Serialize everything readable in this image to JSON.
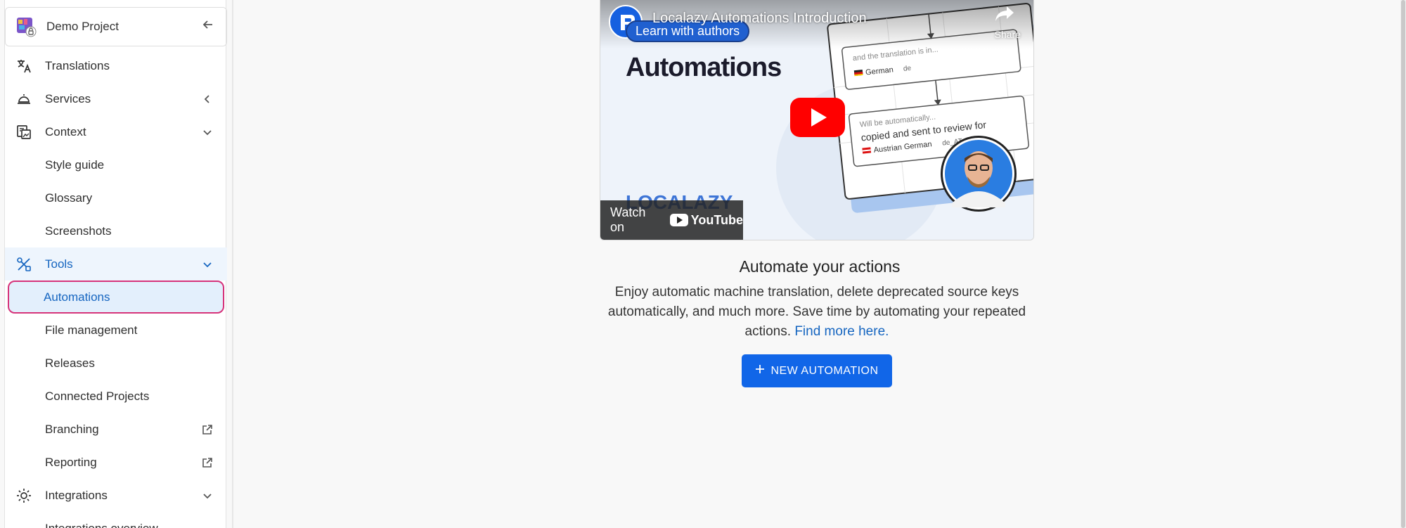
{
  "project": {
    "name": "Demo Project"
  },
  "nav": {
    "translations": "Translations",
    "services": "Services",
    "context": "Context",
    "style_guide": "Style guide",
    "glossary": "Glossary",
    "screenshots": "Screenshots",
    "tools": "Tools",
    "automations": "Automations",
    "file_management": "File management",
    "releases": "Releases",
    "connected_projects": "Connected Projects",
    "branching": "Branching",
    "reporting": "Reporting",
    "integrations": "Integrations",
    "integrations_overview": "Integrations overview"
  },
  "video": {
    "title": "Localazy Automations Introduction",
    "share": "Share",
    "badge": "Learn with authors",
    "headline": "Automations",
    "watch_on": "Watch on",
    "youtube": "YouTube",
    "card1_text": "and the translation is in...",
    "card1_lang": "German",
    "card1_code": "de",
    "card2_text": "Will be automatically...",
    "card2_text2": "copied and sent to review for",
    "card2_lang": "Austrian German",
    "card2_code": "de_AT",
    "brand": "LOCALAZY"
  },
  "empty_state": {
    "title": "Automate your actions",
    "description": "Enjoy automatic machine translation, delete deprecated source keys automatically, and much more. Save time by automating your repeated actions.",
    "link": "Find more here.",
    "button": "NEW AUTOMATION"
  },
  "colors": {
    "accent": "#1166e8",
    "selected_outline": "#d6337a",
    "link": "#1565c0"
  }
}
